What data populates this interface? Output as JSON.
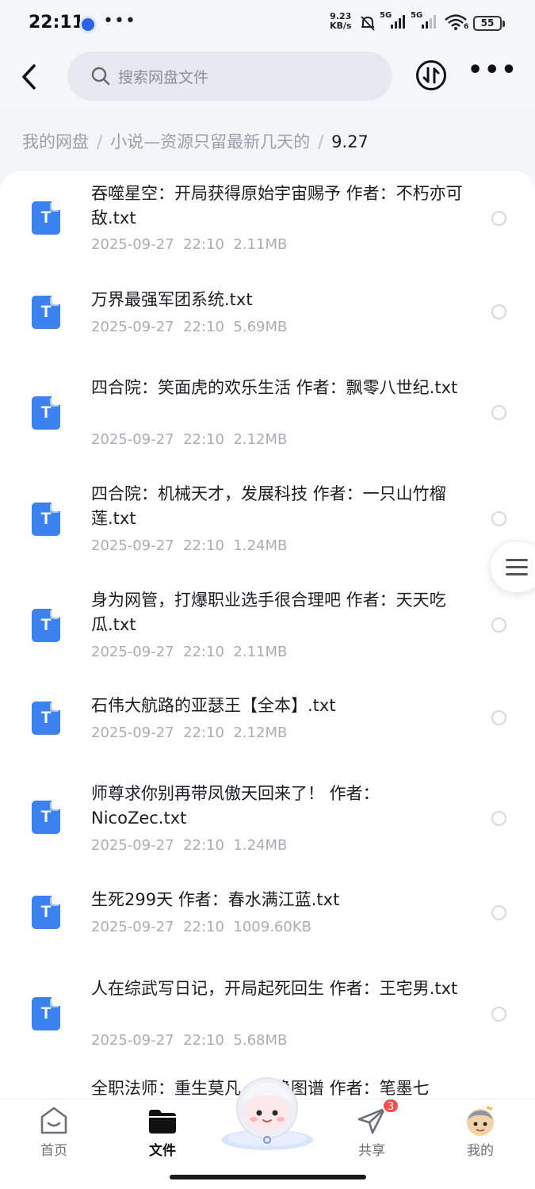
{
  "status_bar": {
    "time": "22:11",
    "dots": "•••",
    "speed_value": "9.23",
    "speed_unit": "KB/s",
    "signal1_label": "5G",
    "signal2_label": "5G",
    "wifi_label": "6",
    "battery": "55"
  },
  "search": {
    "placeholder": "搜索网盘文件"
  },
  "breadcrumb": {
    "items": [
      "我的网盘",
      "小说—资源只留最新几天的"
    ],
    "current": "9.27",
    "separator": "/"
  },
  "file_icon_letter": "T",
  "files": [
    {
      "name": "吞噬星空：开局获得原始宇宙赐予 作者：不朽亦可敌.txt",
      "date": "2025-09-27",
      "time": "22:10",
      "size": "2.11MB"
    },
    {
      "name": "万界最强军团系统.txt",
      "date": "2025-09-27",
      "time": "22:10",
      "size": "5.69MB"
    },
    {
      "name": "四合院：笑面虎的欢乐生活 作者：飘零八世纪.txt",
      "date": "2025-09-27",
      "time": "22:10",
      "size": "2.12MB"
    },
    {
      "name": "四合院：机械天才，发展科技 作者：一只山竹榴莲.txt",
      "date": "2025-09-27",
      "time": "22:10",
      "size": "1.24MB"
    },
    {
      "name": "身为网管，打爆职业选手很合理吧 作者：天天吃瓜.txt",
      "date": "2025-09-27",
      "time": "22:10",
      "size": "2.11MB"
    },
    {
      "name": "石伟大航路的亚瑟王【全本】.txt",
      "date": "2025-09-27",
      "time": "22:10",
      "size": "2.12MB"
    },
    {
      "name": "师尊求你别再带凤傲天回来了！ 作者：NicoZec.txt",
      "date": "2025-09-27",
      "time": "22:10",
      "size": "1.24MB"
    },
    {
      "name": "生死299天 作者：春水满江蓝.txt",
      "date": "2025-09-27",
      "time": "22:10",
      "size": "1009.60KB"
    },
    {
      "name": "人在综武写日记，开局起死回生 作者：王宅男.txt",
      "date": "2025-09-27",
      "time": "22:10",
      "size": "5.68MB"
    },
    {
      "name": "全职法师：重生莫凡，召唤图谱 作者：笔墨七",
      "date": "",
      "time": "",
      "size": ""
    }
  ],
  "tabs": [
    {
      "label": "首页",
      "icon": "home-icon",
      "active": false
    },
    {
      "label": "文件",
      "icon": "folder-icon",
      "active": true
    },
    {
      "label": "共享",
      "icon": "send-icon",
      "active": false,
      "badge": "3"
    },
    {
      "label": "我的",
      "icon": "avatar-icon",
      "active": false
    }
  ],
  "colors": {
    "accent": "#3b82f0",
    "badge": "#ff4d4f",
    "page_bg": "#f3f5f9"
  }
}
